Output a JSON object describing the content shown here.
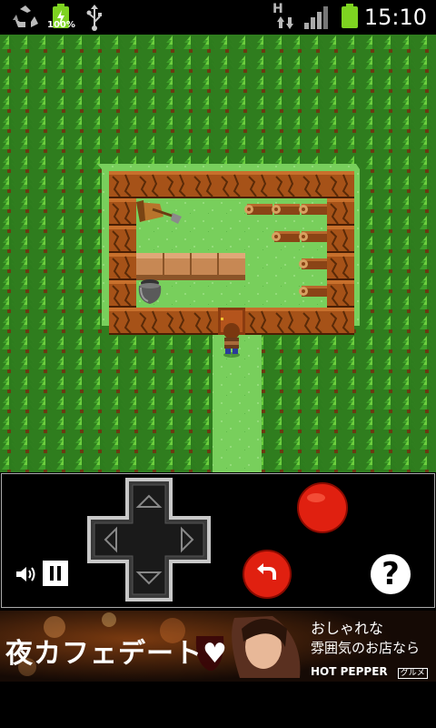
{
  "status_bar": {
    "time": "15:10",
    "battery_label": "100%",
    "icons": [
      "recycle-icon",
      "battery-charging-icon",
      "usb-icon",
      "hspa-data-icon",
      "signal-icon",
      "battery-icon"
    ],
    "network_label": "H"
  },
  "game": {
    "scene": "top-down room in forest",
    "objects": [
      "tree-border",
      "wooden-room-walls",
      "firewood-logs",
      "wooden-table",
      "iron-pot",
      "shovel",
      "door",
      "player-character"
    ]
  },
  "controls": {
    "icons": [
      "dpad-control",
      "action-red-button",
      "undo-red-button",
      "help-button",
      "volume-icon",
      "pause-icon"
    ],
    "help_label": "?"
  },
  "ad": {
    "headline": "夜カフェデート",
    "heart": "♥",
    "tagline_line1": "おしゃれな",
    "tagline_line2": "雰囲気のお店なら",
    "brand": "HOT PEPPER",
    "brand_sub": "グルメ",
    "colors": {
      "headline": "#ffffff",
      "background": "#1a0d06"
    }
  }
}
